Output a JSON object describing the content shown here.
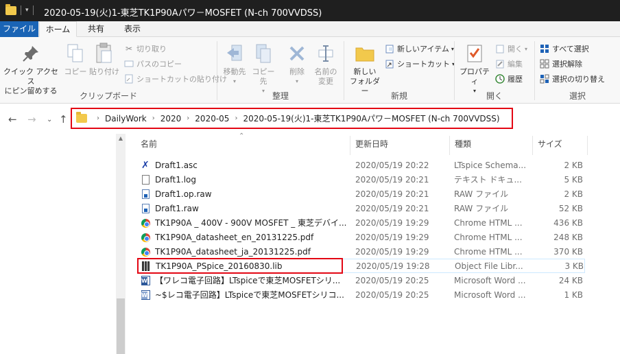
{
  "window": {
    "title": "2020-05-19(火)1-東芝TK1P90Aパワ－MOSFET (N-ch 700VVDSS)"
  },
  "ribbon_tabs": [
    {
      "label": "ファイル"
    },
    {
      "label": "ホーム"
    },
    {
      "label": "共有"
    },
    {
      "label": "表示"
    }
  ],
  "ribbon": {
    "clipboard": {
      "group_label": "クリップボード",
      "pin_label_1": "クイック アクセス",
      "pin_label_2": "にピン留めする",
      "copy_label": "コピー",
      "paste_label": "貼り付け",
      "cut_label": "切り取り",
      "copy_path_label": "パスのコピー",
      "paste_shortcut_label": "ショートカットの貼り付け"
    },
    "organize": {
      "group_label": "整理",
      "move_label": "移動先",
      "copy_to_label": "コピー先",
      "delete_label": "削除",
      "rename_label_1": "名前の",
      "rename_label_2": "変更"
    },
    "new": {
      "group_label": "新規",
      "new_folder_label_1": "新しい",
      "new_folder_label_2": "フォルダー",
      "new_item_label": "新しいアイテム",
      "shortcut_label": "ショートカット"
    },
    "open": {
      "group_label": "開く",
      "properties_label": "プロパティ",
      "open_label": "開く",
      "edit_label": "編集",
      "history_label": "履歴"
    },
    "select": {
      "group_label": "選択",
      "select_all_label": "すべて選択",
      "select_none_label": "選択解除",
      "invert_label": "選択の切り替え"
    }
  },
  "breadcrumb": [
    {
      "label": "DailyWork"
    },
    {
      "label": "2020"
    },
    {
      "label": "2020-05"
    },
    {
      "label": "2020-05-19(火)1-東芝TK1P90Aパワ－MOSFET (N-ch 700VVDSS)"
    }
  ],
  "columns": {
    "name": "名前",
    "date": "更新日時",
    "type": "種類",
    "size": "サイズ"
  },
  "files": [
    {
      "name": "Draft1.asc",
      "date": "2020/05/19 20:22",
      "type": "LTspice Schema...",
      "size": "2 KB",
      "icon": "ltspice-icon"
    },
    {
      "name": "Draft1.log",
      "date": "2020/05/19 20:21",
      "type": "テキスト ドキュ...",
      "size": "5 KB",
      "icon": "text-file-icon"
    },
    {
      "name": "Draft1.op.raw",
      "date": "2020/05/19 20:21",
      "type": "RAW ファイル",
      "size": "2 KB",
      "icon": "raw-file-icon"
    },
    {
      "name": "Draft1.raw",
      "date": "2020/05/19 20:21",
      "type": "RAW ファイル",
      "size": "52 KB",
      "icon": "raw-file-icon"
    },
    {
      "name": "TK1P90A _ 400V - 900V MOSFET _ 東芝デバイ...",
      "date": "2020/05/19 19:29",
      "type": "Chrome HTML ...",
      "size": "436 KB",
      "icon": "chrome-icon"
    },
    {
      "name": "TK1P90A_datasheet_en_20131225.pdf",
      "date": "2020/05/19 19:29",
      "type": "Chrome HTML ...",
      "size": "248 KB",
      "icon": "chrome-icon"
    },
    {
      "name": "TK1P90A_datasheet_ja_20131225.pdf",
      "date": "2020/05/19 19:29",
      "type": "Chrome HTML ...",
      "size": "370 KB",
      "icon": "chrome-icon"
    },
    {
      "name": "TK1P90A_PSpice_20160830.lib",
      "date": "2020/05/19 19:28",
      "type": "Object File Libr...",
      "size": "3 KB",
      "icon": "library-file-icon"
    },
    {
      "name": "【ワレコ電子回路】LTspiceで東芝MOSFETシリ...",
      "date": "2020/05/19 20:25",
      "type": "Microsoft Word ...",
      "size": "24 KB",
      "icon": "word-doc-icon"
    },
    {
      "name": "~$レコ電子回路】LTspiceで東芝MOSFETシリコ...",
      "date": "2020/05/19 20:25",
      "type": "Microsoft Word ...",
      "size": "1 KB",
      "icon": "word-temp-icon"
    }
  ],
  "colors": {
    "highlight": "#e30613",
    "file_tab": "#1a64b5"
  }
}
